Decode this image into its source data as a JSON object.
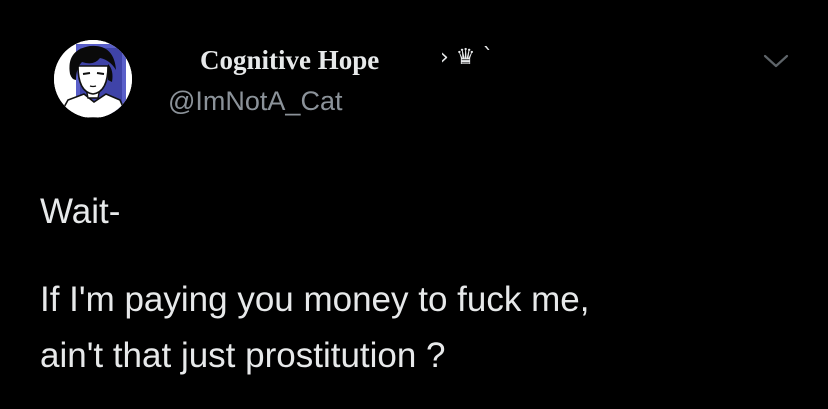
{
  "tweet": {
    "author": {
      "display_name": "Cognitive Hope",
      "name_glyphs": "› ♛ `",
      "handle": "@ImNotA_Cat",
      "avatar_icon": "anime-portrait-avatar"
    },
    "body_lines": [
      "Wait-",
      "If I'm paying you money to fuck me,",
      "ain't that just prostitution ?"
    ],
    "more_icon": "chevron-down-icon"
  },
  "colors": {
    "background": "#000000",
    "text_primary": "#e7e9ea",
    "text_secondary": "#8b9299",
    "avatar_accent": "#5a5fc9"
  }
}
